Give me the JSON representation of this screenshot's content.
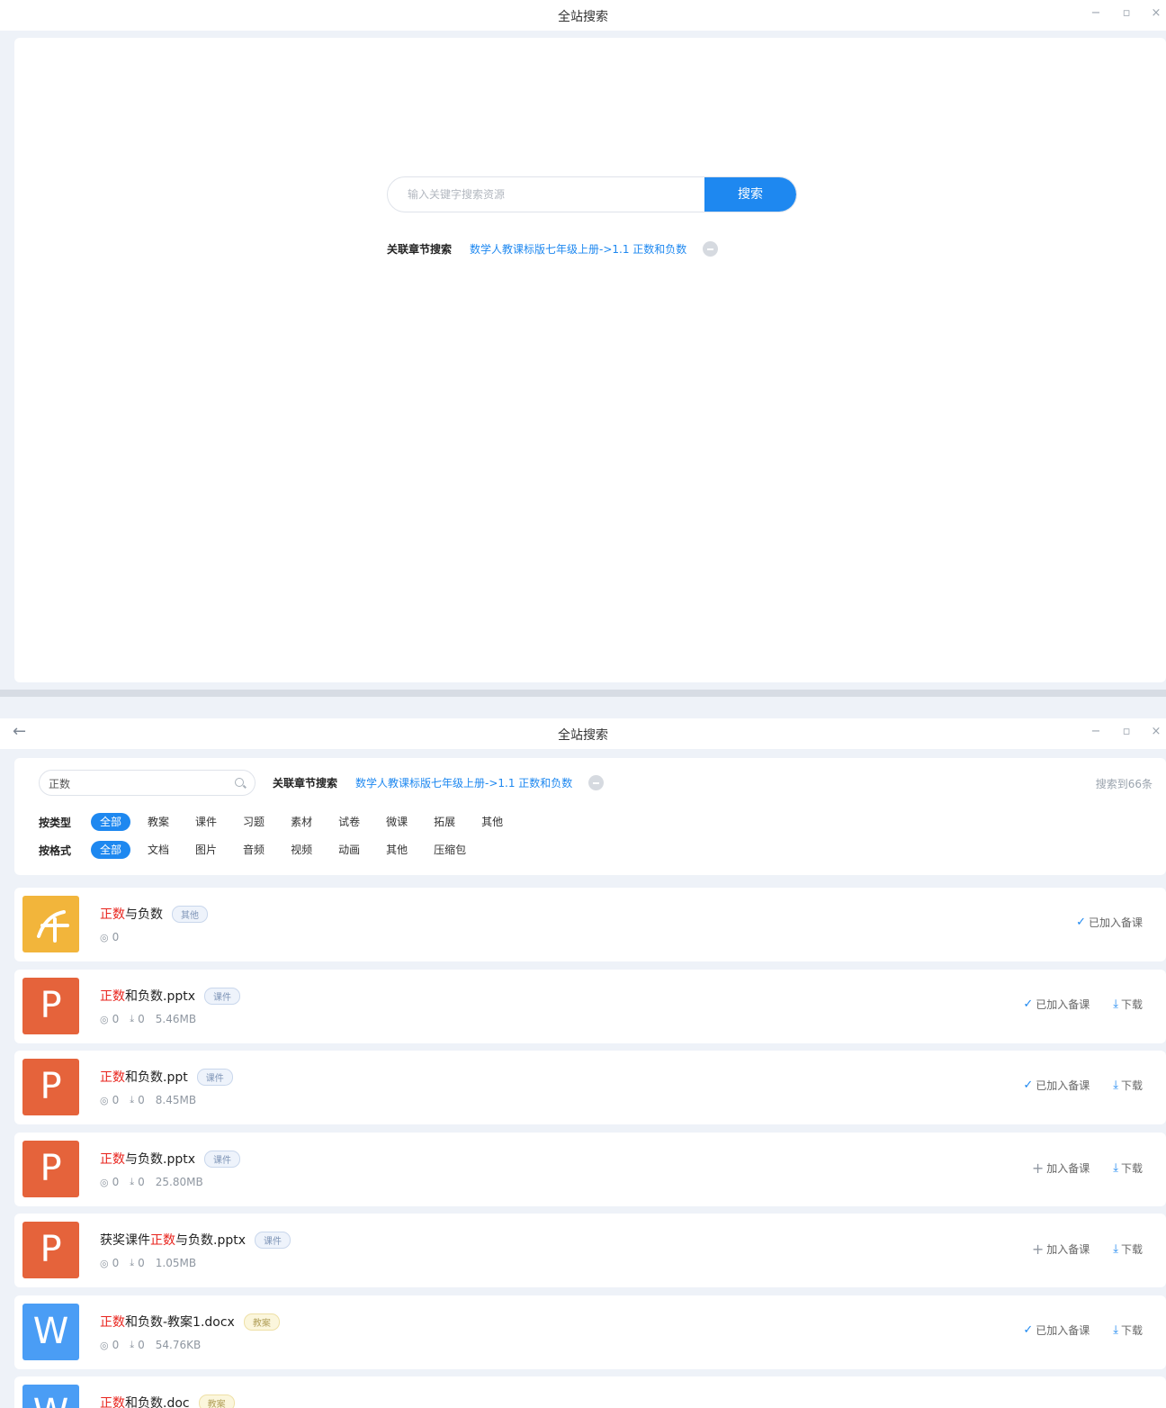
{
  "window1": {
    "title": "全站搜索",
    "search_placeholder": "输入关键字搜索资源",
    "search_button": "搜索",
    "chapter_label": "关联章节搜索",
    "chapter_value": "数学人教课标版七年级上册->1.1 正数和负数"
  },
  "window2": {
    "title": "全站搜索",
    "search_value": "正数",
    "chapter_label": "关联章节搜索",
    "chapter_value": "数学人教课标版七年级上册->1.1 正数和负数",
    "result_count": "搜索到66条",
    "type_filter": {
      "label": "按类型",
      "options": [
        "全部",
        "教案",
        "课件",
        "习题",
        "素材",
        "试卷",
        "微课",
        "拓展",
        "其他"
      ]
    },
    "format_filter": {
      "label": "按格式",
      "options": [
        "全部",
        "文档",
        "图片",
        "音频",
        "视频",
        "动画",
        "其他",
        "压缩包"
      ]
    }
  },
  "window_controls": {
    "minimize": "−",
    "maximize": "▫",
    "close": "×",
    "back": "←"
  },
  "results": [
    {
      "icon": "other",
      "pre": "",
      "hl": "正数",
      "post": "与负数",
      "tag": "其他",
      "tag_color": "blue",
      "views": "0",
      "downloads": "",
      "size": "",
      "added_label": "已加入备课",
      "download_label": ""
    },
    {
      "icon": "ppt",
      "pre": "",
      "hl": "正数",
      "post": "和负数.pptx",
      "tag": "课件",
      "tag_color": "blue",
      "views": "0",
      "downloads": "0",
      "size": "5.46MB",
      "added_label": "已加入备课",
      "download_label": "下载"
    },
    {
      "icon": "ppt",
      "pre": "",
      "hl": "正数",
      "post": "和负数.ppt",
      "tag": "课件",
      "tag_color": "blue",
      "views": "0",
      "downloads": "0",
      "size": "8.45MB",
      "added_label": "已加入备课",
      "download_label": "下载"
    },
    {
      "icon": "ppt",
      "pre": "",
      "hl": "正数",
      "post": "与负数.pptx",
      "tag": "课件",
      "tag_color": "blue",
      "views": "0",
      "downloads": "0",
      "size": "25.80MB",
      "added_label": "加入备课",
      "download_label": "下载"
    },
    {
      "icon": "ppt",
      "pre": "获奖课件",
      "hl": "正数",
      "post": "与负数.pptx",
      "tag": "课件",
      "tag_color": "blue",
      "views": "0",
      "downloads": "0",
      "size": "1.05MB",
      "added_label": "加入备课",
      "download_label": "下载"
    },
    {
      "icon": "word",
      "pre": "",
      "hl": "正数",
      "post": "和负数-教案1.docx",
      "tag": "教案",
      "tag_color": "yellow",
      "views": "0",
      "downloads": "0",
      "size": "54.76KB",
      "added_label": "已加入备课",
      "download_label": "下载"
    },
    {
      "icon": "word",
      "pre": "",
      "hl": "正数",
      "post": "和负数.doc",
      "tag": "教案",
      "tag_color": "yellow",
      "views": "",
      "downloads": "",
      "size": "",
      "added_label": "",
      "download_label": ""
    }
  ],
  "colors": {
    "accent": "#1e88f0",
    "highlight": "#e8231c",
    "ppt": "#e5633b",
    "word": "#4a9df5",
    "other": "#f2b53b"
  }
}
